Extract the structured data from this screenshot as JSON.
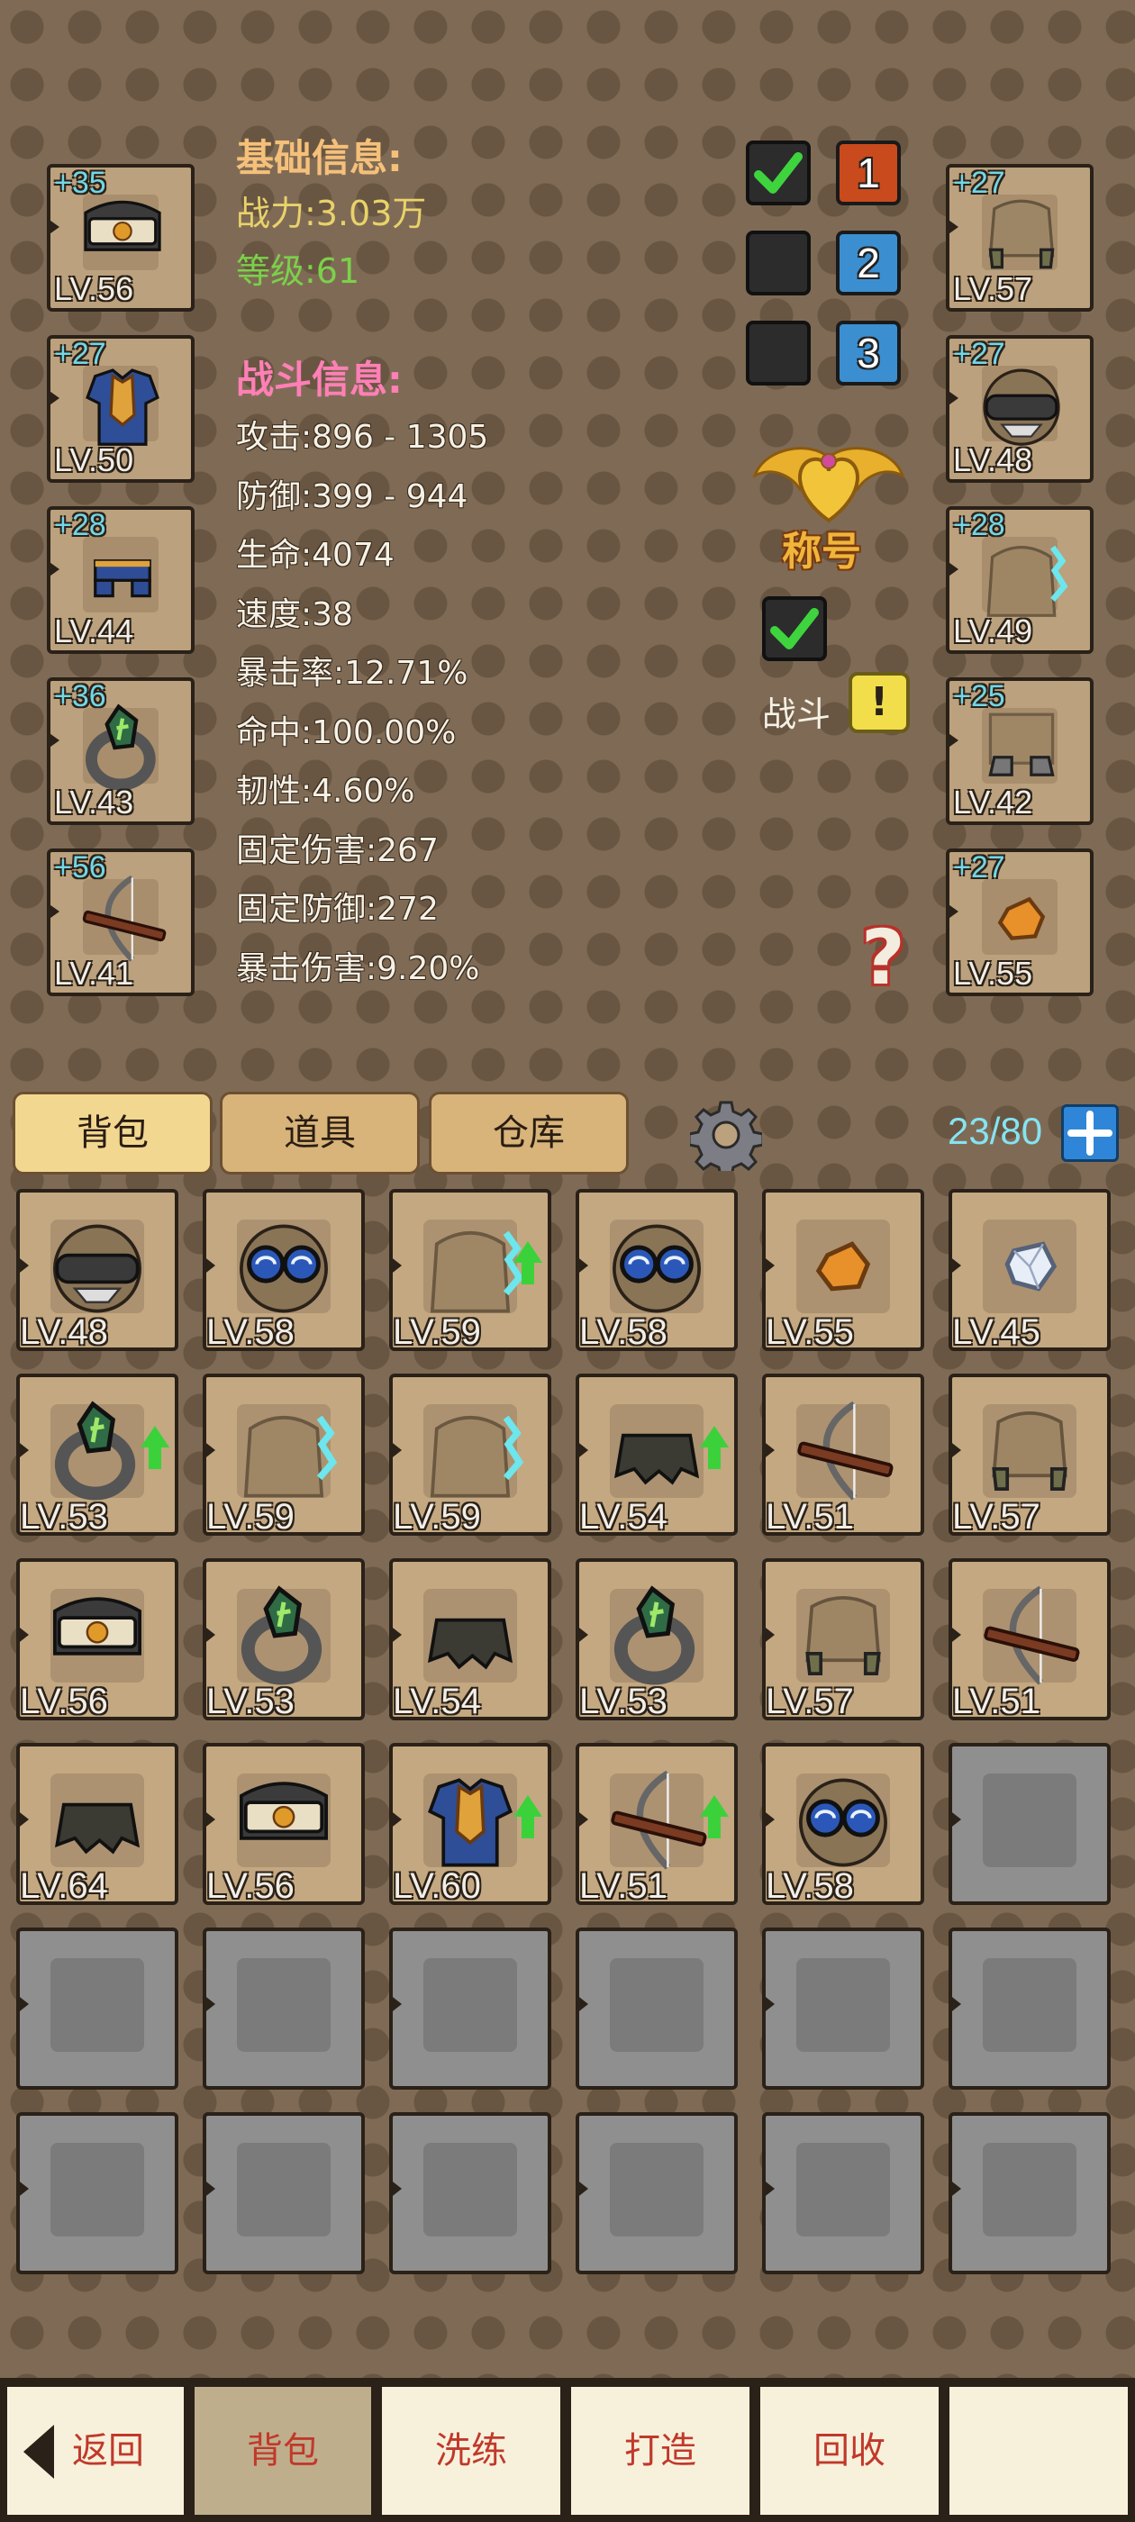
{
  "basic_info": {
    "header": "基础信息:",
    "power": "战力:3.03万",
    "level": "等级:61"
  },
  "combat_info": {
    "header": "战斗信息:",
    "stats": [
      "攻击:896 - 1305",
      "防御:399 - 944",
      "生命:4074",
      "速度:38",
      "暴击率:12.71%",
      "命中:100.00%",
      "韧性:4.60%",
      "固定伤害:267",
      "固定防御:272",
      "暴击伤害:9.20%"
    ]
  },
  "left_equipment": [
    {
      "plus": "+35",
      "level": "LV.56",
      "icon": "headband-icon"
    },
    {
      "plus": "+27",
      "level": "LV.50",
      "icon": "armor-icon"
    },
    {
      "plus": "+28",
      "level": "LV.44",
      "icon": "pants-icon"
    },
    {
      "plus": "+36",
      "level": "LV.43",
      "icon": "ring-icon"
    },
    {
      "plus": "+56",
      "level": "LV.41",
      "icon": "bow-icon"
    }
  ],
  "right_equipment": [
    {
      "plus": "+27",
      "level": "LV.57",
      "icon": "gloves-icon"
    },
    {
      "plus": "+27",
      "level": "LV.48",
      "icon": "mask-icon"
    },
    {
      "plus": "+28",
      "level": "LV.49",
      "icon": "cape-icon"
    },
    {
      "plus": "+25",
      "level": "LV.42",
      "icon": "boots-icon"
    },
    {
      "plus": "+27",
      "level": "LV.55",
      "icon": "amulet-icon"
    }
  ],
  "loadouts": [
    {
      "number": "1",
      "checked": true,
      "color": "#c94a1c"
    },
    {
      "number": "2",
      "checked": false,
      "color": "#3b8fd0"
    },
    {
      "number": "3",
      "checked": false,
      "color": "#3b8fd0"
    }
  ],
  "title_badge": {
    "label": "称号"
  },
  "battle": {
    "label": "战斗",
    "alert": "!"
  },
  "help": {
    "label": "?"
  },
  "tabs": {
    "bag": "背包",
    "items": "道具",
    "storage": "仓库"
  },
  "capacity": "23/80",
  "inventory": [
    {
      "level": "LV.48",
      "icon": "mask-icon",
      "upgrade": false
    },
    {
      "level": "LV.58",
      "icon": "goggles-icon",
      "upgrade": false
    },
    {
      "level": "LV.59",
      "icon": "cape-icon",
      "upgrade": true
    },
    {
      "level": "LV.58",
      "icon": "goggles-icon",
      "upgrade": false
    },
    {
      "level": "LV.55",
      "icon": "amulet-icon",
      "upgrade": false
    },
    {
      "level": "LV.45",
      "icon": "gem-icon",
      "upgrade": false
    },
    {
      "level": "LV.53",
      "icon": "ring-icon",
      "upgrade": true
    },
    {
      "level": "LV.59",
      "icon": "cape-icon",
      "upgrade": false
    },
    {
      "level": "LV.59",
      "icon": "cape-icon",
      "upgrade": false
    },
    {
      "level": "LV.54",
      "icon": "skirt-icon",
      "upgrade": true
    },
    {
      "level": "LV.51",
      "icon": "bow-icon",
      "upgrade": false
    },
    {
      "level": "LV.57",
      "icon": "gloves-icon",
      "upgrade": false
    },
    {
      "level": "LV.56",
      "icon": "headband-icon",
      "upgrade": false
    },
    {
      "level": "LV.53",
      "icon": "ring-icon",
      "upgrade": false
    },
    {
      "level": "LV.54",
      "icon": "skirt-icon",
      "upgrade": false
    },
    {
      "level": "LV.53",
      "icon": "ring-icon",
      "upgrade": false
    },
    {
      "level": "LV.57",
      "icon": "gloves-icon",
      "upgrade": false
    },
    {
      "level": "LV.51",
      "icon": "bow-icon",
      "upgrade": false
    },
    {
      "level": "LV.64",
      "icon": "skirt-icon",
      "upgrade": false
    },
    {
      "level": "LV.56",
      "icon": "headband-icon",
      "upgrade": false
    },
    {
      "level": "LV.60",
      "icon": "armor-icon",
      "upgrade": true
    },
    {
      "level": "LV.51",
      "icon": "bow-icon",
      "upgrade": true
    },
    {
      "level": "LV.58",
      "icon": "goggles-icon",
      "upgrade": false
    }
  ],
  "inventory_total_slots": 36,
  "bottom_nav": {
    "back": "返回",
    "bag": "背包",
    "refine": "洗练",
    "forge": "打造",
    "recycle": "回收",
    "extra": ""
  }
}
